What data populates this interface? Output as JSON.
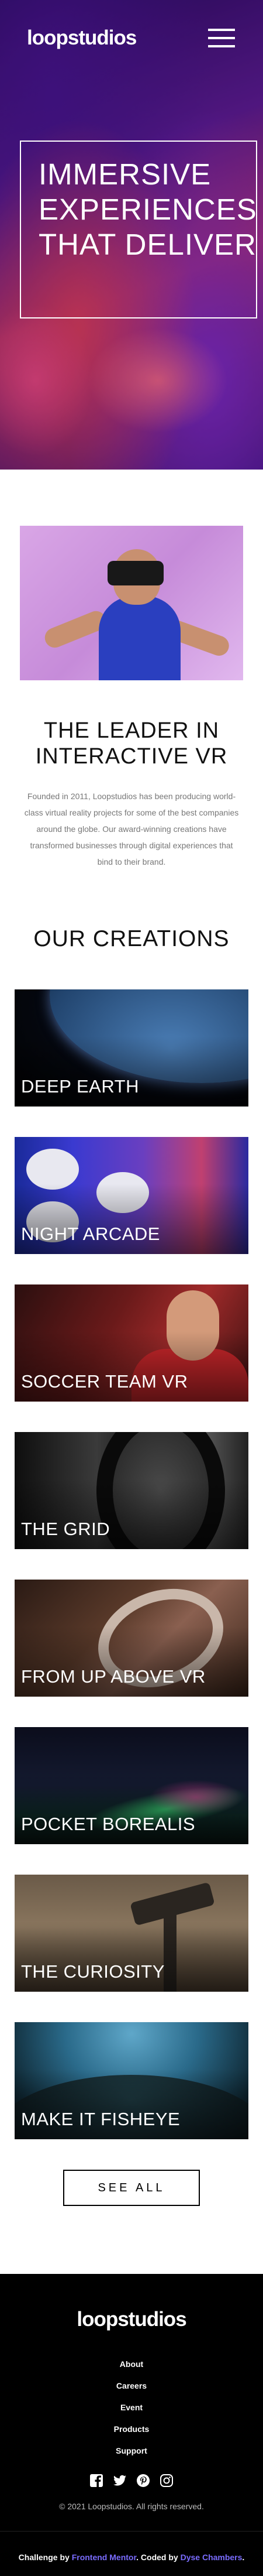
{
  "header": {
    "logo": "loopstudios",
    "menu_icon": "hamburger-menu-icon"
  },
  "hero": {
    "title": "Immersive experiences that deliver"
  },
  "intro": {
    "title": "The leader in interactive VR",
    "text": "Founded in 2011, Loopstudios has been producing world-class virtual reality projects for some of the best companies around the globe. Our award-winning creations have transformed businesses through digital experiences that bind to their brand."
  },
  "creations": {
    "title": "Our creations",
    "items": [
      {
        "label": "Deep earth"
      },
      {
        "label": "Night arcade"
      },
      {
        "label": "Soccer team VR"
      },
      {
        "label": "The grid"
      },
      {
        "label": "From up above VR"
      },
      {
        "label": "Pocket borealis"
      },
      {
        "label": "The curiosity"
      },
      {
        "label": "Make it fisheye"
      }
    ],
    "see_all": "See all"
  },
  "footer": {
    "logo": "loopstudios",
    "nav": [
      "About",
      "Careers",
      "Event",
      "Products",
      "Support"
    ],
    "socials": [
      "facebook-icon",
      "twitter-icon",
      "pinterest-icon",
      "instagram-icon"
    ],
    "copyright": "© 2021 Loopstudios. All rights reserved."
  },
  "attribution": {
    "prefix": "Challenge by",
    "challenge_link": "Frontend Mentor",
    "middle": "Coded by",
    "author_link": "Dyse Chambers"
  }
}
